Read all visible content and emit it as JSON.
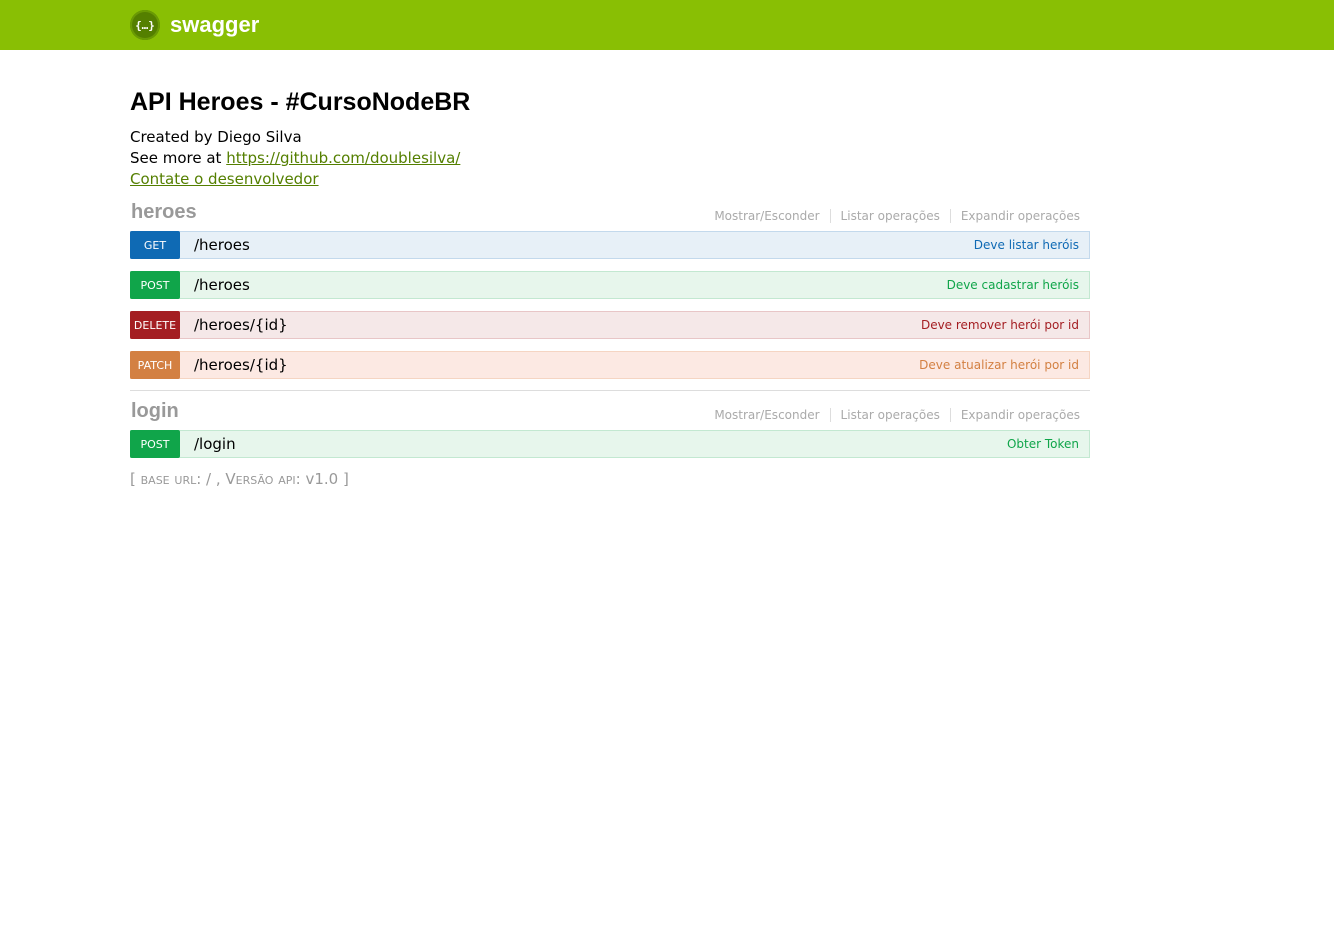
{
  "header": {
    "logo_icon": "{…}",
    "logo_text": "swagger"
  },
  "info": {
    "title": "API Heroes - #CursoNodeBR",
    "created_by": "Created by Diego Silva",
    "see_more_prefix": "See more at ",
    "see_more_link": "https://github.com/doublesilva/",
    "contact_link": "Contate o desenvolvedor"
  },
  "resource_links": {
    "toggle": "Mostrar/Esconder",
    "list": "Listar operações",
    "expand": "Expandir operações"
  },
  "resources": [
    {
      "name": "heroes",
      "operations": [
        {
          "method": "GET",
          "path": "/heroes",
          "summary": "Deve listar heróis"
        },
        {
          "method": "POST",
          "path": "/heroes",
          "summary": "Deve cadastrar heróis"
        },
        {
          "method": "DELETE",
          "path": "/heroes/{id}",
          "summary": "Deve remover herói por id"
        },
        {
          "method": "PATCH",
          "path": "/heroes/{id}",
          "summary": "Deve atualizar herói por id"
        }
      ]
    },
    {
      "name": "login",
      "operations": [
        {
          "method": "POST",
          "path": "/login",
          "summary": "Obter Token"
        }
      ]
    }
  ],
  "footer": {
    "open": "[ ",
    "base_url_label": "base url",
    "base_url_value": ": / , ",
    "version_label": "Versão api",
    "version_value": ": v1.0 ]"
  },
  "colors": {
    "header": "#89bf04",
    "get": "#0f6ab4",
    "post": "#10a54a",
    "delete": "#a41e22",
    "patch": "#d38042"
  }
}
